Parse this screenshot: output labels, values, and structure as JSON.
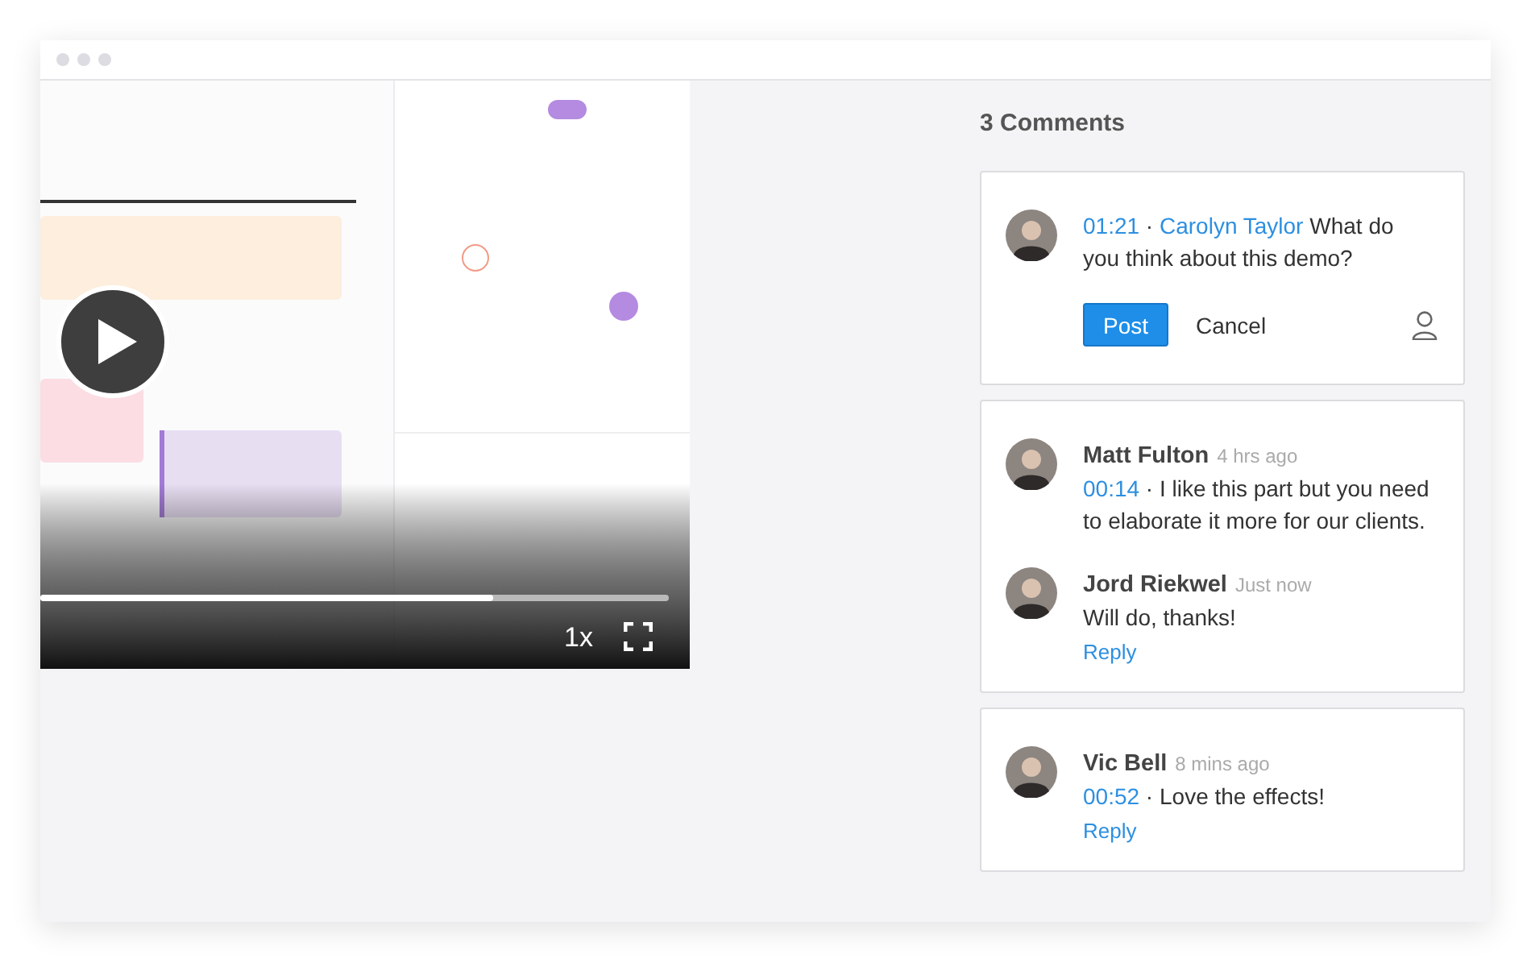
{
  "video": {
    "speed": "1x",
    "level": 0.72,
    "playing": false
  },
  "comments": {
    "heading": "3 Comments",
    "draft": {
      "time": "01:21",
      "separator": "·",
      "author": "Carolyn Taylor",
      "text": "What do you think about this demo?",
      "post": "Post",
      "cancel": "Cancel"
    },
    "threads": [
      {
        "entries": [
          {
            "author": "Matt Fulton",
            "ago": "4 hrs ago",
            "time": "00:14",
            "separator": "·",
            "text": "I like this part but you need to elaborate it more for our clients."
          },
          {
            "author": "Jord Riekwel",
            "ago": "Just now",
            "text": "Will do, thanks!",
            "reply": "Reply"
          }
        ]
      },
      {
        "entries": [
          {
            "author": "Vic Bell",
            "ago": "8 mins ago",
            "time": "00:52",
            "separator": "·",
            "text": "Love the effects!",
            "reply": "Reply"
          }
        ]
      }
    ]
  }
}
